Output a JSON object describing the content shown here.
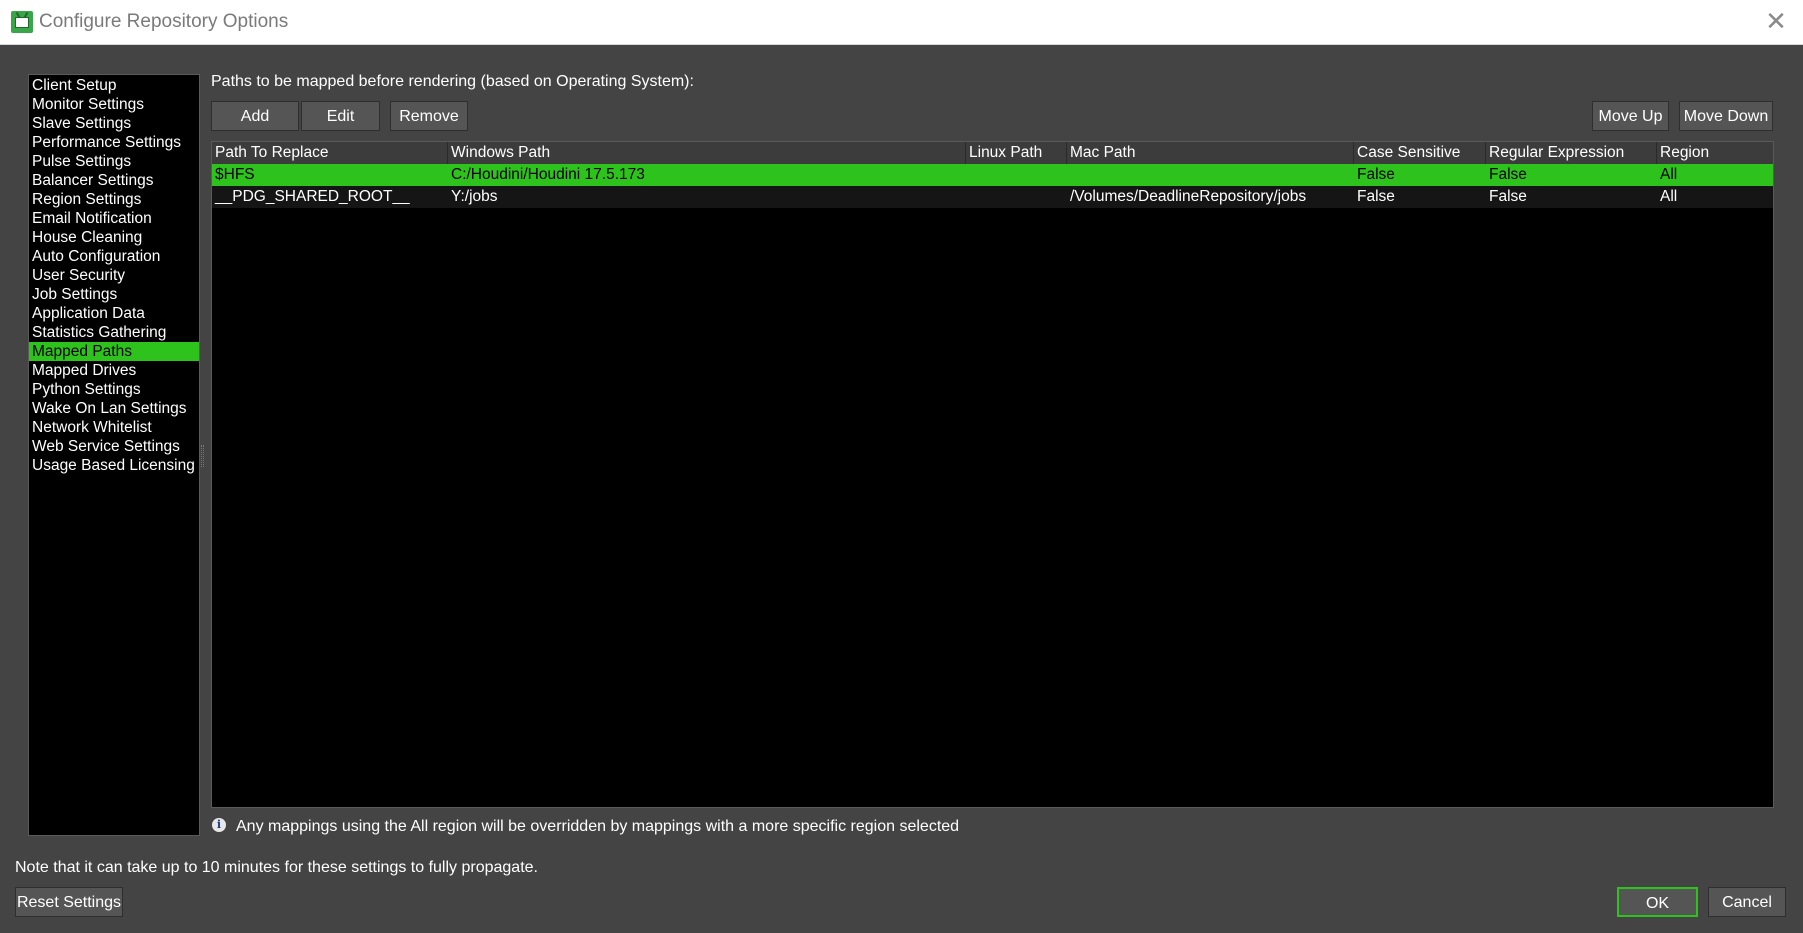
{
  "window": {
    "title": "Configure Repository Options",
    "close_icon": "close-icon"
  },
  "sidebar": {
    "items": [
      {
        "label": "Client Setup"
      },
      {
        "label": "Monitor Settings"
      },
      {
        "label": "Slave Settings"
      },
      {
        "label": "Performance Settings"
      },
      {
        "label": "Pulse Settings"
      },
      {
        "label": "Balancer Settings"
      },
      {
        "label": "Region Settings"
      },
      {
        "label": "Email Notification"
      },
      {
        "label": "House Cleaning"
      },
      {
        "label": "Auto Configuration"
      },
      {
        "label": "User Security"
      },
      {
        "label": "Job Settings"
      },
      {
        "label": "Application Data"
      },
      {
        "label": "Statistics Gathering"
      },
      {
        "label": "Mapped Paths"
      },
      {
        "label": "Mapped Drives"
      },
      {
        "label": "Python Settings"
      },
      {
        "label": "Wake On Lan Settings"
      },
      {
        "label": "Network Whitelist"
      },
      {
        "label": "Web Service Settings"
      },
      {
        "label": "Usage Based Licensing"
      }
    ],
    "selected": "Mapped Paths"
  },
  "main": {
    "section_label": "Paths to be mapped before rendering (based on Operating System):",
    "buttons": {
      "add": "Add",
      "edit": "Edit",
      "remove": "Remove",
      "move_up": "Move Up",
      "move_down": "Move Down"
    },
    "table": {
      "columns": [
        "Path To Replace",
        "Windows Path",
        "Linux Path",
        "Mac Path",
        "Case Sensitive",
        "Regular Expression",
        "Region"
      ],
      "rows": [
        [
          "$HFS",
          "C:/Houdini/Houdini 17.5.173",
          "",
          "",
          "False",
          "False",
          "All"
        ],
        [
          "__PDG_SHARED_ROOT__",
          "Y:/jobs",
          "",
          "/Volumes/DeadlineRepository/jobs",
          "False",
          "False",
          "All"
        ]
      ]
    },
    "info_text": "Any mappings using the All region will be overridden by mappings with a more specific region selected"
  },
  "footer": {
    "note": "Note that it can take up to 10 minutes for these settings to fully propagate.",
    "reset_label": "Reset Settings",
    "ok_label": "OK",
    "cancel_label": "Cancel"
  },
  "colors": {
    "accent": "#2ec21c",
    "background": "#444444",
    "panel": "#000000"
  }
}
